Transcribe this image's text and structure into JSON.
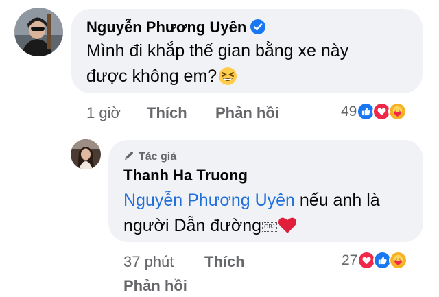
{
  "comment": {
    "author": "Nguyễn Phương Uyên",
    "verified": true,
    "lines": [
      "Mình đi khắp thế gian bằng xe này",
      "được không em?"
    ],
    "time": "1 giờ",
    "like_label": "Thích",
    "reply_label": "Phản hồi",
    "reaction_count": "49",
    "reactions": [
      "like-reaction-icon",
      "love-reaction-icon",
      "care-reaction-icon"
    ]
  },
  "reply": {
    "author_badge": "Tác giả",
    "author": "Thanh Ha Truong",
    "mention": "Nguyễn Phương Uyên",
    "line1_rest": " nếu anh là",
    "line2": "người Dẫn đường",
    "obj_marker": "OBJ",
    "time": "37 phút",
    "like_label": "Thích",
    "reply_label": "Phản hồi",
    "reaction_count": "27",
    "reactions": [
      "love-reaction-icon",
      "like-reaction-icon",
      "care-reaction-icon"
    ]
  },
  "colors": {
    "like": "#1877f2",
    "love": "#f02849",
    "care": "#f7b125",
    "mention": "#216fdb",
    "meta": "#65676b",
    "bubble": "#f0f2f5"
  }
}
